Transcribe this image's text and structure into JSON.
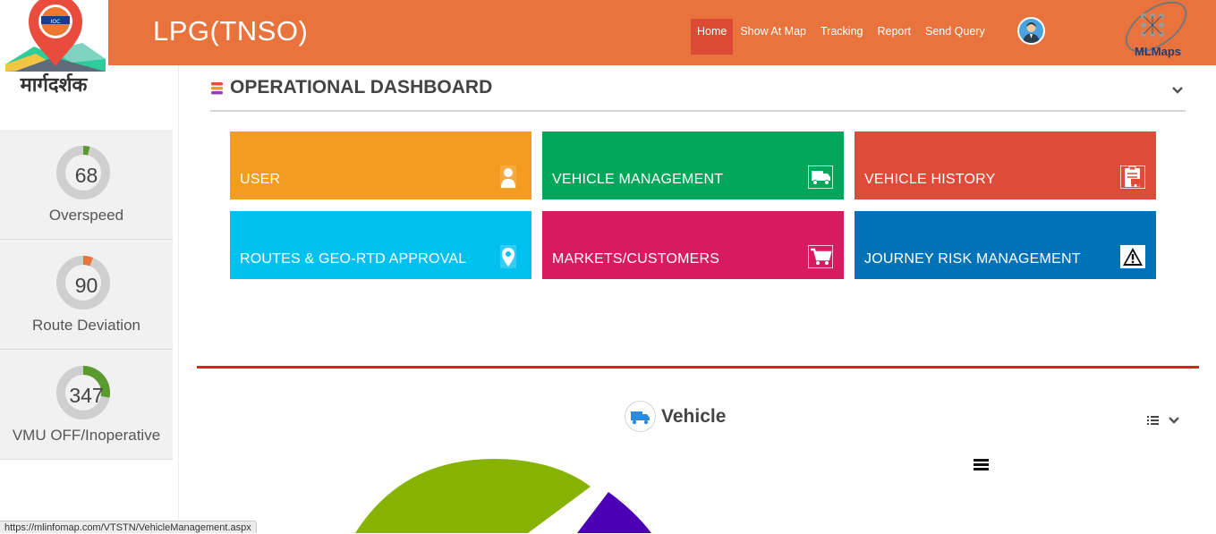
{
  "header": {
    "logo_text": "मार्गदर्शक",
    "app_title": "LPG(TNSO)",
    "nav": [
      {
        "label": "Home",
        "active": true
      },
      {
        "label": "Show At Map",
        "active": false
      },
      {
        "label": "Tracking",
        "active": false
      },
      {
        "label": "Report",
        "active": false
      },
      {
        "label": "Send Query",
        "active": false
      }
    ],
    "brand_logo_text": "MLMaps",
    "colors": {
      "bar": "#e8733c",
      "active_tab": "#dc4a36"
    }
  },
  "sidebar": {
    "cards": [
      {
        "value": "68",
        "label": "Overspeed",
        "fraction": 0.04,
        "color": "#5b9a2f"
      },
      {
        "value": "90",
        "label": "Route Deviation",
        "fraction": 0.06,
        "color": "#e8733c"
      },
      {
        "value": "347",
        "label": "VMU OFF/Inoperative",
        "fraction": 0.28,
        "color": "#5b9a2f"
      }
    ]
  },
  "dashboard": {
    "title": "OPERATIONAL DASHBOARD",
    "tiles": [
      {
        "label": "USER",
        "color": "#f39c1f",
        "icon": "user-icon"
      },
      {
        "label": "VEHICLE MANAGEMENT",
        "color": "#00a65a",
        "icon": "truck-icon"
      },
      {
        "label": "VEHICLE HISTORY",
        "color": "#dd4b39",
        "icon": "history-clipboard-icon"
      },
      {
        "label": "ROUTES & GEO-RTD APPROVAL",
        "color": "#00c0ef",
        "icon": "map-pin-icon"
      },
      {
        "label": "MARKETS/CUSTOMERS",
        "color": "#d81b60",
        "icon": "cart-icon"
      },
      {
        "label": "JOURNEY RISK MANAGEMENT",
        "color": "#0073b7",
        "icon": "warning-icon"
      }
    ]
  },
  "vehicle": {
    "title": "Vehicle",
    "pie_colors": [
      "#86b300",
      "#4b00b5"
    ]
  },
  "status_bar": {
    "url": "https://mlinfomap.com/VTSTN/VehicleManagement.aspx"
  }
}
